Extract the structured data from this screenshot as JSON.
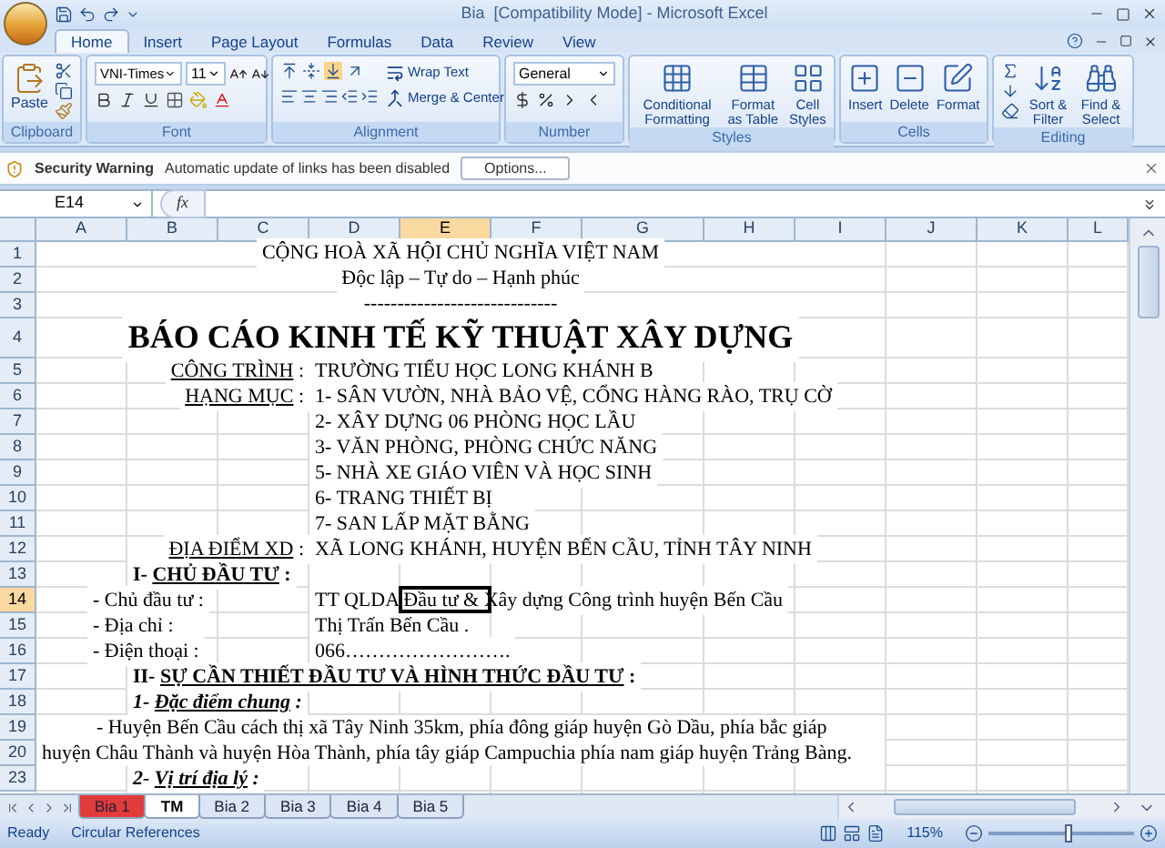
{
  "window": {
    "title": "Bia  [Compatibility Mode] - Microsoft Excel"
  },
  "ribbon_tabs": [
    {
      "label": "Home",
      "selected": true
    },
    {
      "label": "Insert",
      "selected": false
    },
    {
      "label": "Page Layout",
      "selected": false
    },
    {
      "label": "Formulas",
      "selected": false
    },
    {
      "label": "Data",
      "selected": false
    },
    {
      "label": "Review",
      "selected": false
    },
    {
      "label": "View",
      "selected": false
    }
  ],
  "ribbon": {
    "clipboard": {
      "label": "Clipboard",
      "paste": "Paste"
    },
    "font": {
      "label": "Font",
      "name": "VNI-Times",
      "size": "11"
    },
    "alignment": {
      "label": "Alignment",
      "wrap_text": "Wrap Text",
      "merge_center": "Merge & Center"
    },
    "number": {
      "label": "Number",
      "format": "General"
    },
    "styles": {
      "label": "Styles",
      "buttons": [
        "Conditional Formatting",
        "Format as Table",
        "Cell Styles"
      ]
    },
    "cells": {
      "label": "Cells",
      "buttons": [
        "Insert",
        "Delete",
        "Format"
      ]
    },
    "editing": {
      "label": "Editing",
      "buttons": [
        "Sort & Filter",
        "Find & Select"
      ]
    }
  },
  "security_bar": {
    "title": "Security Warning",
    "message": "Automatic update of links has been disabled",
    "button": "Options..."
  },
  "formula_bar": {
    "name_box": "E14",
    "function_label": "fx"
  },
  "columns": [
    {
      "label": "A",
      "selected": false
    },
    {
      "label": "B",
      "selected": false
    },
    {
      "label": "C",
      "selected": false
    },
    {
      "label": "D",
      "selected": false
    },
    {
      "label": "E",
      "selected": true
    },
    {
      "label": "F",
      "selected": false
    },
    {
      "label": "G",
      "selected": false
    },
    {
      "label": "H",
      "selected": false
    },
    {
      "label": "I",
      "selected": false
    },
    {
      "label": "J",
      "selected": false
    },
    {
      "label": "K",
      "selected": false
    },
    {
      "label": "L",
      "selected": false
    }
  ],
  "rows": [
    {
      "number": "1",
      "selected": false,
      "cells": [
        {
          "kind": "banner",
          "text": "CỘNG HOÀ XÃ HỘI CHỦ NGHĨA VIỆT NAM"
        }
      ]
    },
    {
      "number": "2",
      "selected": false,
      "cells": [
        {
          "kind": "banner",
          "text": "Độc lập – Tự do – Hạnh phúc"
        }
      ]
    },
    {
      "number": "3",
      "selected": false,
      "cells": [
        {
          "kind": "banner",
          "text": "-----------------------------"
        }
      ]
    },
    {
      "number": "4",
      "selected": false,
      "cells": [
        {
          "kind": "title",
          "text": "BÁO CÁO KINH TẾ KỸ THUẬT XÂY DỰNG"
        }
      ]
    },
    {
      "number": "5",
      "selected": false,
      "cells": [
        {
          "kind": "label",
          "parts": [
            {
              "text": "CÔNG TRÌNH",
              "underline": true
            },
            {
              "text": " :",
              "underline": false
            }
          ]
        },
        {
          "kind": "value",
          "text": "TRƯỜNG TIỂU HỌC LONG KHÁNH B"
        }
      ]
    },
    {
      "number": "6",
      "selected": false,
      "cells": [
        {
          "kind": "label",
          "parts": [
            {
              "text": "HẠNG MỤC",
              "underline": true
            },
            {
              "text": " :",
              "underline": false
            }
          ]
        },
        {
          "kind": "value",
          "text": "1- SÂN VƯỜN, NHÀ BẢO VỆ, CỔNG HÀNG RÀO, TRỤ CỜ"
        }
      ]
    },
    {
      "number": "7",
      "selected": false,
      "cells": [
        {
          "kind": "value",
          "text": "2- XÂY DỰNG 06 PHÒNG HỌC LẦU"
        }
      ]
    },
    {
      "number": "8",
      "selected": false,
      "cells": [
        {
          "kind": "value",
          "text": "3- VĂN PHÒNG, PHÒNG CHỨC NĂNG"
        }
      ]
    },
    {
      "number": "9",
      "selected": false,
      "cells": [
        {
          "kind": "value",
          "text": "5- NHÀ XE GIÁO VIÊN VÀ HỌC SINH"
        }
      ]
    },
    {
      "number": "10",
      "selected": false,
      "cells": [
        {
          "kind": "value",
          "text": "6- TRANG THIẾT BỊ"
        }
      ]
    },
    {
      "number": "11",
      "selected": false,
      "cells": [
        {
          "kind": "value",
          "text": "7- SAN LẤP MẶT BẰNG"
        }
      ]
    },
    {
      "number": "12",
      "selected": false,
      "cells": [
        {
          "kind": "label",
          "parts": [
            {
              "text": "ĐỊA ĐIỂM XD",
              "underline": true
            },
            {
              "text": " :",
              "underline": false
            }
          ]
        },
        {
          "kind": "value",
          "text": "XÃ LONG KHÁNH, HUYỆN BẾN CẦU, TỈNH TÂY NINH"
        }
      ]
    },
    {
      "number": "13",
      "selected": false,
      "cells": [
        {
          "kind": "section",
          "parts": [
            {
              "text": "I- ",
              "underline": false
            },
            {
              "text": "CHỦ ĐẦU TƯ",
              "underline": true
            },
            {
              "text": " :",
              "underline": false
            }
          ]
        }
      ]
    },
    {
      "number": "14",
      "selected": true,
      "cells": [
        {
          "kind": "field",
          "text": "- Chủ đầu tư :"
        },
        {
          "kind": "value",
          "text": "TT QLDA Đầu tư & Xây dựng Công trình huyện Bến Cầu"
        }
      ]
    },
    {
      "number": "15",
      "selected": false,
      "cells": [
        {
          "kind": "field",
          "text": "- Địa chỉ :"
        },
        {
          "kind": "value",
          "text": "Thị Trấn Bến Cầu ."
        }
      ]
    },
    {
      "number": "16",
      "selected": false,
      "cells": [
        {
          "kind": "field",
          "text": "- Điện thoại :"
        },
        {
          "kind": "value",
          "text": "066……………………."
        }
      ]
    },
    {
      "number": "17",
      "selected": false,
      "cells": [
        {
          "kind": "section",
          "parts": [
            {
              "text": "II- ",
              "underline": false
            },
            {
              "text": "SỰ CẦN THIẾT ĐẦU TƯ VÀ HÌNH THỨC ĐẦU TƯ",
              "underline": true
            },
            {
              "text": " :",
              "underline": false
            }
          ]
        }
      ]
    },
    {
      "number": "18",
      "selected": false,
      "cells": [
        {
          "kind": "subsection",
          "parts": [
            {
              "text": "1-  ",
              "underline": false
            },
            {
              "text": "Đặc điểm chung",
              "underline": true
            },
            {
              "text": " :",
              "underline": false
            }
          ]
        }
      ]
    },
    {
      "number": "19",
      "selected": false,
      "cells": [
        {
          "kind": "paragraph",
          "text": "- Huyện Bến Cầu cách thị xã Tây Ninh 35km, phía đông giáp huyện Gò Dầu, phía bắc giáp huyện Châu Thành và huyện Hòa Thành, phía tây giáp Campuchia phía nam giáp huyện Trảng Bàng."
        }
      ]
    },
    {
      "number": "20",
      "selected": false,
      "cells": []
    },
    {
      "number": "23",
      "selected": false,
      "cells": [
        {
          "kind": "subsection",
          "parts": [
            {
              "text": "2-  ",
              "underline": false
            },
            {
              "text": "Vị trí địa lý",
              "underline": true
            },
            {
              "text": " :",
              "underline": false
            }
          ]
        }
      ]
    }
  ],
  "sheet_tabs": [
    {
      "label": "Bia 1",
      "selected": false,
      "color": "#e23b3b"
    },
    {
      "label": "TM",
      "selected": true,
      "color": "#ffffff"
    },
    {
      "label": "Bia 2",
      "selected": false,
      "color": "#dbe5f3"
    },
    {
      "label": "Bia 3",
      "selected": false,
      "color": "#dbe5f3"
    },
    {
      "label": "Bia 4",
      "selected": false,
      "color": "#dbe5f3"
    },
    {
      "label": "Bia 5",
      "selected": false,
      "color": "#dbe5f3"
    }
  ],
  "status_bar": {
    "mode": "Ready",
    "message": "Circular References",
    "zoom": "115%",
    "zoom_slider": {
      "level": 0.55
    }
  }
}
